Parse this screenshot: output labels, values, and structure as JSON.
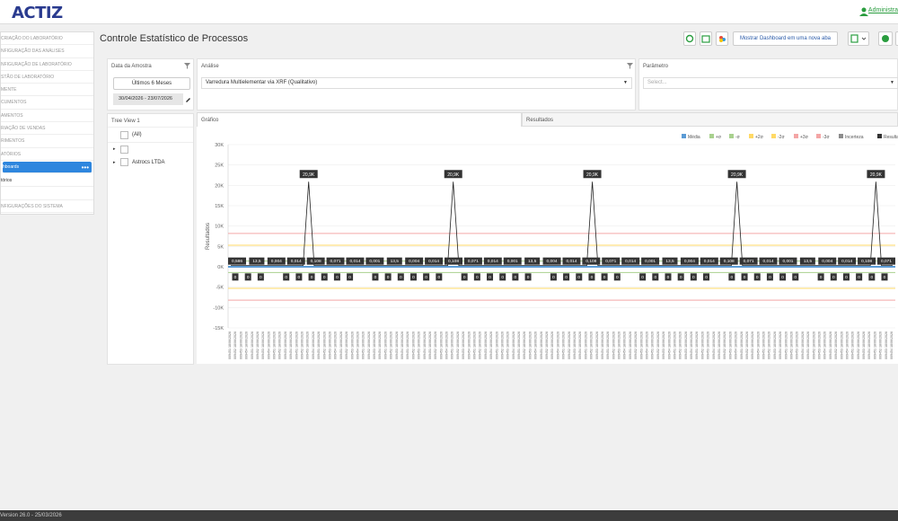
{
  "header": {
    "logo": "ACTIZ",
    "user": "Administra",
    "user_icon": "user-icon"
  },
  "sidebar": {
    "items": [
      {
        "label": "CRIAÇÃO DO LABORATÓRIO"
      },
      {
        "label": "NFIGURAÇÃO DAS ANÁLISES"
      },
      {
        "label": "NFIGURAÇÃO DE LABORATÓRIO"
      },
      {
        "label": "STÃO DE LABORATÓRIO"
      },
      {
        "label": "MENTE"
      },
      {
        "label": "CUMENTOS"
      },
      {
        "label": "AMENTOS"
      },
      {
        "label": "RIAÇÃO DE VENDAS"
      },
      {
        "label": "RIMENTOS"
      },
      {
        "label": "ATÓRIOS"
      },
      {
        "label": "hboards",
        "active": true
      },
      {
        "label": "tórios",
        "sub": true
      },
      {
        "label": ""
      },
      {
        "label": "NFIGURAÇÕES DO SISTEMA"
      }
    ]
  },
  "page": {
    "title": "Controle Estatístico de Processos"
  },
  "toolbar": {
    "open_new_tab": "Mostrar Dashboard em uma nova aba"
  },
  "filters": {
    "date": {
      "label": "Data da Amostra",
      "preset": "Últimos 6 Meses",
      "range": "30/04/2026 - 23/07/2026"
    },
    "analysis": {
      "label": "Análise",
      "value": "Varredura Multielementar via XRF (Qualitativo)"
    },
    "parameter": {
      "label": "Parâmetro",
      "placeholder": "Select..."
    }
  },
  "tree": {
    "title": "Tree View 1",
    "all": "(All)",
    "nodes": [
      "",
      "Astrocs LTDA"
    ]
  },
  "tabs": {
    "chart": "Gráfico",
    "results": "Resultados"
  },
  "chart_data": {
    "type": "line",
    "title": "",
    "ylabel": "Resultados",
    "xlabel": "",
    "ylim": [
      -15000,
      30000
    ],
    "yticks": [
      "30K",
      "25K",
      "20K",
      "15K",
      "10K",
      "5K",
      "0K",
      "-5K",
      "-10K",
      "-15K"
    ],
    "legend_position": "top-right",
    "legend": [
      {
        "name": "Média",
        "color": "#5b9bd5"
      },
      {
        "name": "+σ",
        "color": "#a9d18e"
      },
      {
        "name": "-σ",
        "color": "#a9d18e"
      },
      {
        "name": "+2σ",
        "color": "#ffd966"
      },
      {
        "name": "-2σ",
        "color": "#ffd966"
      },
      {
        "name": "+3σ",
        "color": "#f4a6a6"
      },
      {
        "name": "-3σ",
        "color": "#f4a6a6"
      },
      {
        "name": "Incerteza",
        "color": "#8c8c8c"
      },
      {
        "name": "Resultado",
        "color": "#333333"
      }
    ],
    "lines": {
      "mean": 0,
      "sd1": 1400,
      "sd2": 5300,
      "sd3": 8200
    },
    "series": [
      {
        "name": "Resultado",
        "upper_labels": [
          "0,586",
          "13,5",
          "0,004",
          "0,014",
          "0,108",
          "0,071",
          "0,014",
          "0,001",
          "13,5",
          "0,004",
          "0,014",
          "0,108",
          "0,071",
          "0,014",
          "0,001",
          "13,5",
          "0,004",
          "0,014",
          "0,108",
          "0,071",
          "0,014",
          "0,001",
          "13,5",
          "0,004",
          "0,014",
          "0,108",
          "0,071",
          "0,014",
          "0,001",
          "13,5",
          "0,004",
          "0,014",
          "0,108",
          "0,071"
        ],
        "peak_label": "20,9K",
        "peak_value": 20900,
        "peak_count": 5
      }
    ],
    "lower_label": "0",
    "xtick_samples": [
      "009451\n18/06/2026",
      "009452\n18/06/2026",
      "009453\n18/06/2026",
      "009454\n18/06/2026"
    ]
  },
  "footer": {
    "version": "Version 26.0 - 25/03/2026"
  }
}
